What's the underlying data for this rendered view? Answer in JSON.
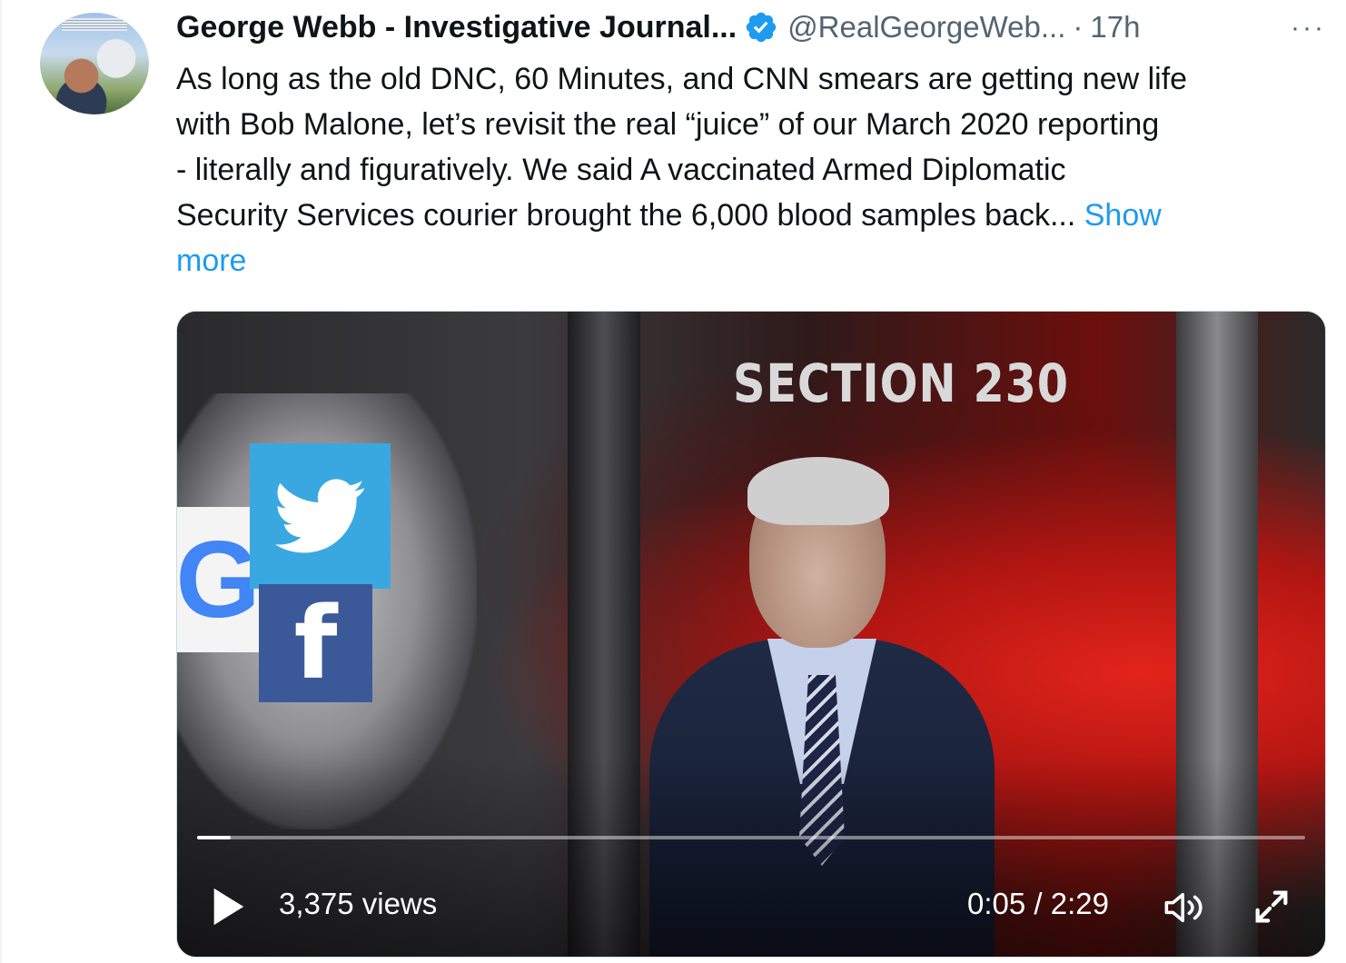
{
  "tweet": {
    "display_name": "George Webb - Investigative Journal...",
    "handle": "@RealGeorgeWeb...",
    "separator": "·",
    "time": "17h",
    "more": "···",
    "text_lines": [
      "As long as the old DNC, 60 Minutes, and CNN smears are getting new life",
      "with Bob Malone, let’s revisit the real “juice” of our March 2020 reporting",
      "- literally and figuratively.  We said A vaccinated Armed Diplomatic",
      "Security Services courier brought the 6,000 blood samples back... "
    ],
    "show_more_1": "Show",
    "show_more_2": "more"
  },
  "video": {
    "overlay_title": "SECTION 230",
    "views": "3,375 views",
    "timecode": "0:05 / 2:29",
    "progress": 0.03
  },
  "colors": {
    "accent": "#1d9bf0",
    "text": "#0f1419",
    "secondary": "#536471"
  },
  "icons": [
    "verified-badge-icon",
    "more-icon",
    "play-icon",
    "volume-icon",
    "fullscreen-icon",
    "twitter-logo-icon",
    "google-logo-icon",
    "facebook-logo-icon"
  ]
}
